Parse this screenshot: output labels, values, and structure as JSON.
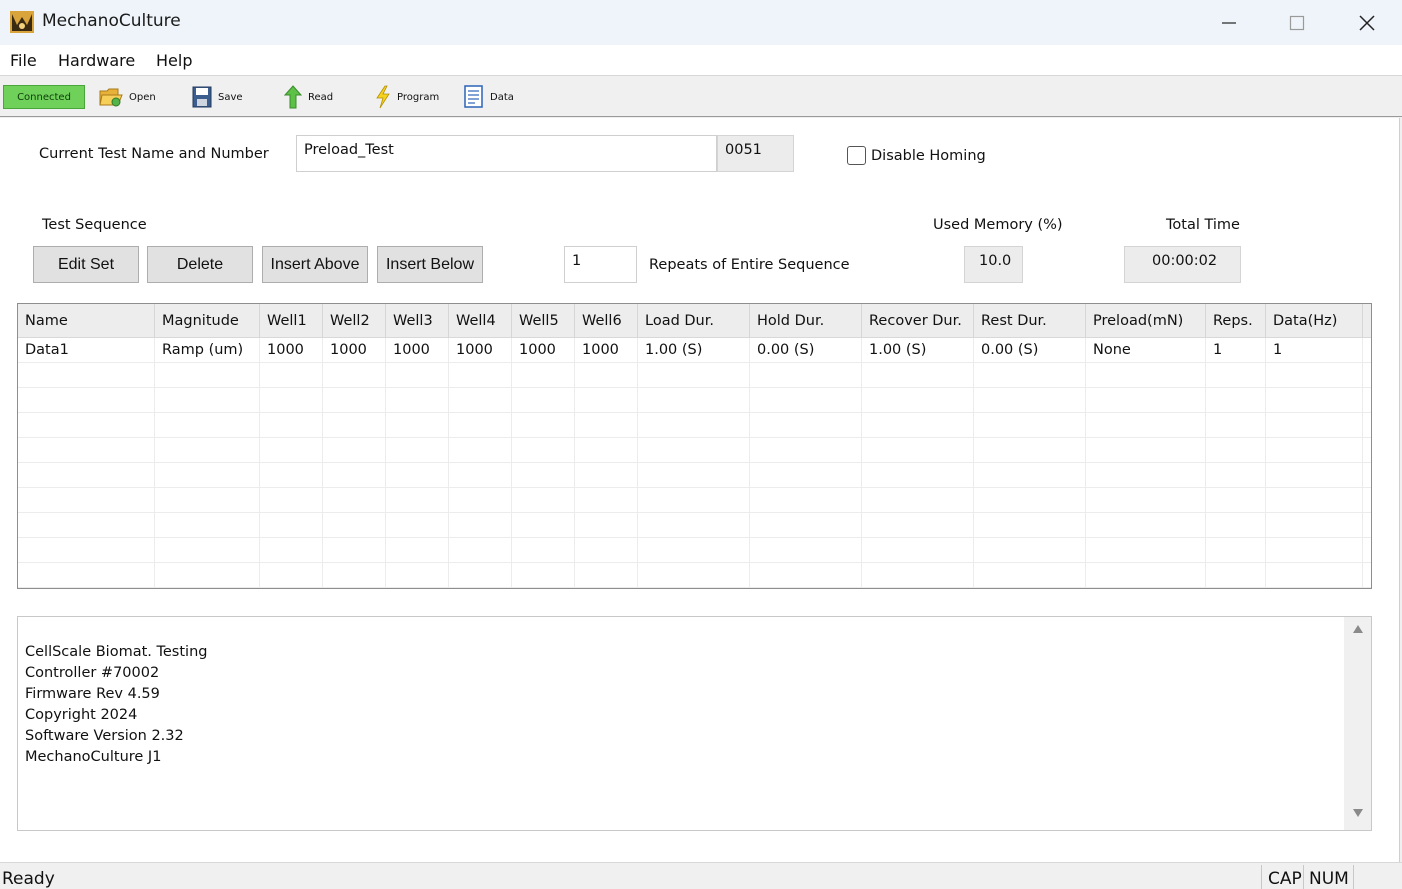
{
  "window": {
    "title": "MechanoCulture"
  },
  "menu": {
    "items": [
      "File",
      "Hardware",
      "Help"
    ]
  },
  "toolbar": {
    "status": "Connected",
    "status_color": "#6fd15a",
    "buttons": [
      {
        "label": "Open",
        "icon": "folder-open-icon"
      },
      {
        "label": "Save",
        "icon": "floppy-disk-icon"
      },
      {
        "label": "Read",
        "icon": "green-arrow-up-icon"
      },
      {
        "label": "Program",
        "icon": "lightning-bolt-icon"
      },
      {
        "label": "Data",
        "icon": "data-sheet-icon"
      }
    ]
  },
  "test": {
    "name_label": "Current Test Name and Number",
    "name_value": "Preload_Test",
    "number_value": "0051",
    "disable_homing_label": "Disable Homing",
    "disable_homing_checked": false
  },
  "sequence": {
    "label": "Test Sequence",
    "buttons": {
      "edit_set": "Edit Set",
      "delete": "Delete",
      "insert_above": "Insert Above",
      "insert_below": "Insert Below"
    },
    "repeats_value": "1",
    "repeats_label": "Repeats of Entire Sequence",
    "memory_label": "Used Memory (%)",
    "memory_value": "10.0",
    "total_time_label": "Total Time",
    "total_time_value": "00:00:02"
  },
  "grid": {
    "columns": [
      "Name",
      "Magnitude",
      "Well1",
      "Well2",
      "Well3",
      "Well4",
      "Well5",
      "Well6",
      "Load Dur.",
      "Hold Dur.",
      "Recover Dur.",
      "Rest Dur.",
      "Preload(mN)",
      "Reps.",
      "Data(Hz)"
    ],
    "rows": [
      [
        "Data1",
        "Ramp (um)",
        "1000",
        "1000",
        "1000",
        "1000",
        "1000",
        "1000",
        "1.00 (S)",
        "0.00 (S)",
        "1.00 (S)",
        "0.00 (S)",
        "None",
        "1",
        "1"
      ]
    ]
  },
  "console": {
    "lines": [
      "CellScale Biomat. Testing",
      "Controller #70002",
      "Firmware Rev 4.59",
      "Copyright 2024",
      "Software Version 2.32",
      "MechanoCulture J1"
    ]
  },
  "status": {
    "text": "Ready",
    "cap": "CAP",
    "num": "NUM"
  }
}
